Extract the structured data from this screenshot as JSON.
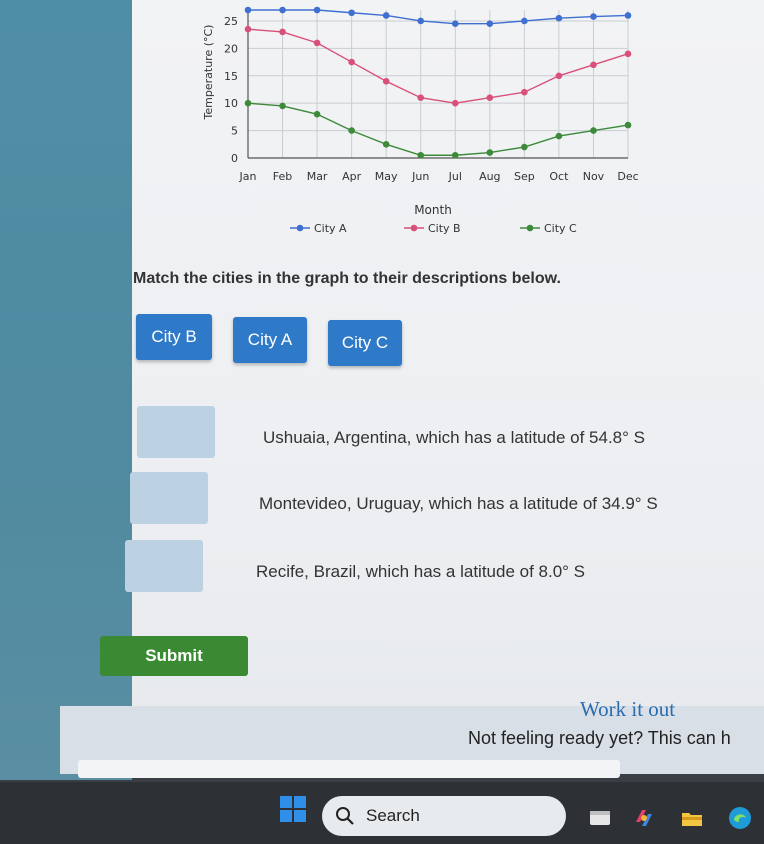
{
  "chart": {
    "ylabel": "Temperature (°C)",
    "xlabel": "Month",
    "yticks": [
      "0",
      "5",
      "10",
      "15",
      "20",
      "25"
    ],
    "months": [
      "Jan",
      "Feb",
      "Mar",
      "Apr",
      "May",
      "Jun",
      "Jul",
      "Aug",
      "Sep",
      "Oct",
      "Nov",
      "Dec"
    ],
    "legend": [
      "City A",
      "City B",
      "City C"
    ]
  },
  "chart_data": {
    "type": "line",
    "categories": [
      "Jan",
      "Feb",
      "Mar",
      "Apr",
      "May",
      "Jun",
      "Jul",
      "Aug",
      "Sep",
      "Oct",
      "Nov",
      "Dec"
    ],
    "series": [
      {
        "name": "City A",
        "color": "#3f6fd1",
        "values": [
          27,
          27,
          27,
          26.5,
          26,
          25,
          24.5,
          24.5,
          25,
          25.5,
          25.8,
          26
        ]
      },
      {
        "name": "City B",
        "color": "#d9507a",
        "values": [
          23.5,
          23,
          21,
          17.5,
          14,
          11,
          10,
          11,
          12,
          15,
          17,
          19
        ]
      },
      {
        "name": "City C",
        "color": "#3c8a3a",
        "values": [
          10,
          9.5,
          8,
          5,
          2.5,
          0.5,
          0.5,
          1,
          2,
          4,
          5,
          6
        ]
      }
    ],
    "xlabel": "Month",
    "ylabel": "Temperature (°C)",
    "ylim": [
      0,
      27
    ],
    "grid": true,
    "legend": "bottom"
  },
  "buttons": {
    "city_b": "City B",
    "city_a": "City A",
    "city_c": "City C",
    "submit": "Submit"
  },
  "instruction": "Match the cities in the graph to their descriptions below.",
  "descriptions": [
    "Ushuaia, Argentina, which has a latitude of 54.8° S",
    "Montevideo, Uruguay, which has a latitude of 34.9° S",
    "Recife, Brazil, which has a latitude of 8.0° S"
  ],
  "footer": {
    "work_it_out": "Work it out",
    "not_ready": "Not feeling ready yet? This can h"
  },
  "taskbar": {
    "search": "Search"
  }
}
